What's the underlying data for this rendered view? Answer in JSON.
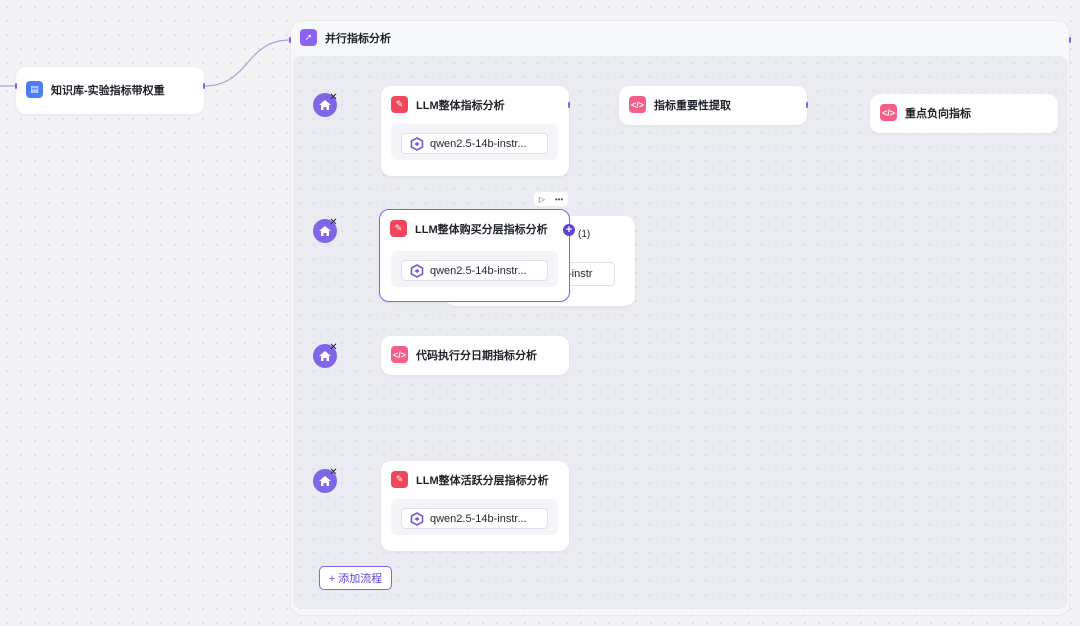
{
  "kb_node": {
    "title": "知识库-实验指标带权重",
    "icon": "book-icon"
  },
  "group": {
    "title": "并行指标分析",
    "icon": "rocket-icon"
  },
  "nodes": {
    "llm_overall": {
      "title": "LLM整体指标分析",
      "model": "qwen2.5-14b-instr..."
    },
    "key_extract": {
      "title": "指标重要性提取"
    },
    "key_negative": {
      "title": "重点负向指标"
    },
    "llm_purchase": {
      "title": "LLM整体购买分层指标分析",
      "model": "qwen2.5-14b-instr...",
      "hidden_model": "-instr"
    },
    "code_daily": {
      "title": "代码执行分日期指标分析"
    },
    "llm_active": {
      "title": "LLM整体活跃分层指标分析",
      "model": "qwen2.5-14b-instr..."
    }
  },
  "branch_count": "(1)",
  "add_flow_label": "+ 添加流程",
  "colors": {
    "accent": "#7f65e8",
    "llm_icon": "#f0475c",
    "code_icon": "#f55e87",
    "kb_icon": "#4d7cf7"
  }
}
